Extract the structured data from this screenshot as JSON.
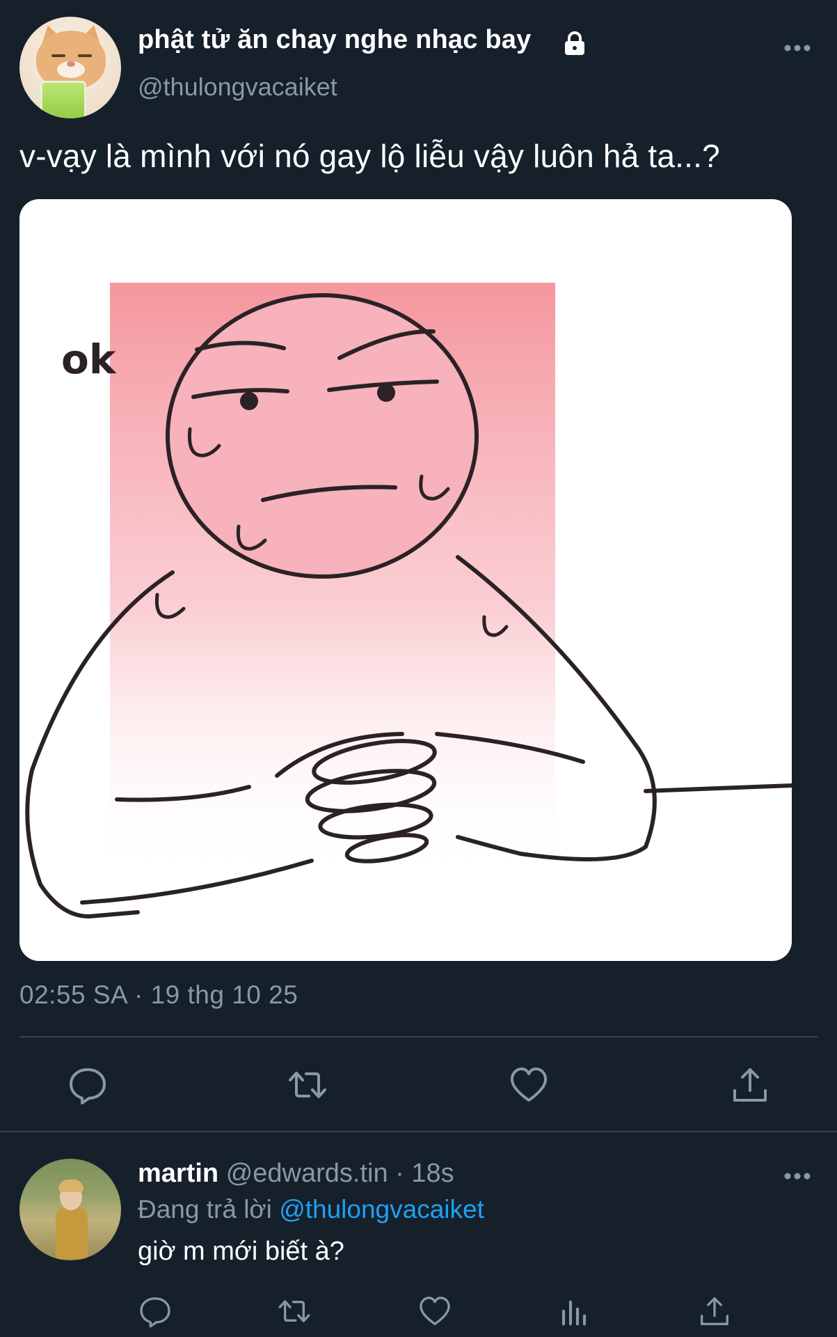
{
  "tweet": {
    "author_name": "phật tử ăn chay nghe nhạc bay",
    "author_handle": "@thulongvacaiket",
    "protected_icon": "lock-icon",
    "text": "v-vạy là mình với nó gay lộ liễu vậy luôn hả ta...?",
    "media": {
      "caption_in_image": "ok"
    },
    "timestamp": "02:55 SA · 19 thg 10 25",
    "actions": [
      "reply-icon",
      "retweet-icon",
      "like-icon",
      "share-icon"
    ]
  },
  "reply": {
    "author_name": "martin",
    "author_meta": " @edwards.tin · 18s",
    "replying_prefix": "Đang trả lời ",
    "replying_handle": "@thulongvacaiket",
    "text": "giờ m mới biết à?",
    "actions": [
      "reply-icon",
      "retweet-icon",
      "like-icon",
      "analytics-icon",
      "share-icon"
    ]
  },
  "colors": {
    "background": "#15202b",
    "secondary_text": "#8899a6",
    "link": "#1da1f2",
    "divider": "#38444d"
  }
}
